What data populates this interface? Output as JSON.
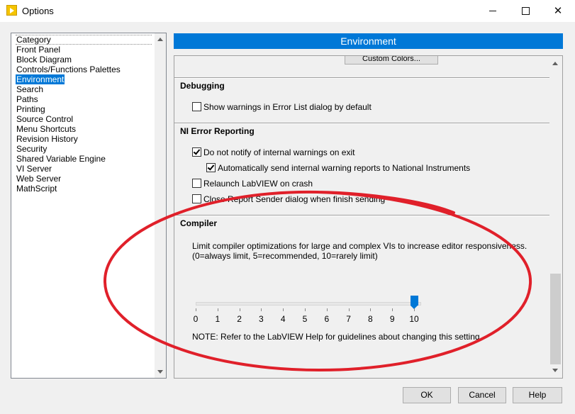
{
  "window": {
    "title": "Options",
    "icon": "labview-icon",
    "close_glyph": "✕"
  },
  "categories": [
    {
      "label": "Category",
      "header": true
    },
    {
      "label": "Front Panel"
    },
    {
      "label": "Block Diagram"
    },
    {
      "label": "Controls/Functions Palettes"
    },
    {
      "label": "Environment",
      "selected": true
    },
    {
      "label": "Search"
    },
    {
      "label": "Paths"
    },
    {
      "label": "Printing"
    },
    {
      "label": "Source Control"
    },
    {
      "label": "Menu Shortcuts"
    },
    {
      "label": "Revision History"
    },
    {
      "label": "Security"
    },
    {
      "label": "Shared Variable Engine"
    },
    {
      "label": "VI Server"
    },
    {
      "label": "Web Server"
    },
    {
      "label": "MathScript"
    }
  ],
  "panel": {
    "title": "Environment",
    "custom_colors_label": "Custom Colors...",
    "debugging": {
      "title": "Debugging",
      "show_warnings": {
        "label": "Show warnings in Error List dialog by default",
        "checked": false
      }
    },
    "error_reporting": {
      "title": "NI Error Reporting",
      "do_not_notify": {
        "label": "Do not notify of internal warnings on exit",
        "checked": true
      },
      "auto_send": {
        "label": "Automatically send internal warning reports to National Instruments",
        "checked": true
      },
      "relaunch": {
        "label": "Relaunch LabVIEW on crash",
        "checked": false
      },
      "close_sender": {
        "label": "Close Report Sender dialog when finish sending",
        "checked": false
      }
    },
    "compiler": {
      "title": "Compiler",
      "description_line1": "Limit compiler optimizations for large and complex VIs to increase editor responsiveness.",
      "description_line2": "(0=always limit, 5=recommended, 10=rarely limit)",
      "slider_min": 0,
      "slider_max": 10,
      "slider_value": 10,
      "tick_labels": [
        "0",
        "1",
        "2",
        "3",
        "4",
        "5",
        "6",
        "7",
        "8",
        "9",
        "10"
      ],
      "note": "NOTE: Refer to the LabVIEW Help for guidelines about changing this setting."
    }
  },
  "buttons": {
    "ok": "OK",
    "cancel": "Cancel",
    "help": "Help"
  },
  "colors": {
    "accent": "#0078d7",
    "annotation": "#e0202a"
  }
}
